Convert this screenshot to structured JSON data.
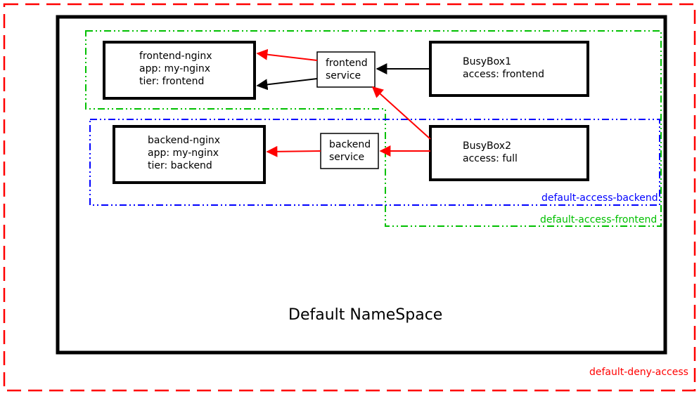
{
  "title": "Default NameSpace",
  "policies": {
    "deny": {
      "label": "default-deny-access",
      "color": "#ff0000"
    },
    "front": {
      "label": "default-access-frontend",
      "color": "#00c000"
    },
    "back": {
      "label": "default-access-backend",
      "color": "#0000ff"
    }
  },
  "nodes": {
    "frontend_nginx": {
      "line1": "frontend-nginx",
      "line2": "app: my-nginx",
      "line3": "tier: frontend"
    },
    "backend_nginx": {
      "line1": "backend-nginx",
      "line2": "app: my-nginx",
      "line3": "tier: backend"
    },
    "frontend_svc": {
      "line1": "frontend",
      "line2": "service"
    },
    "backend_svc": {
      "line1": "backend",
      "line2": "service"
    },
    "busybox1": {
      "line1": "BusyBox1",
      "line2": "access: frontend"
    },
    "busybox2": {
      "line1": "BusyBox2",
      "line2": "access: full"
    }
  },
  "colors": {
    "arrow_black": "#000000",
    "arrow_red": "#ff0000"
  }
}
